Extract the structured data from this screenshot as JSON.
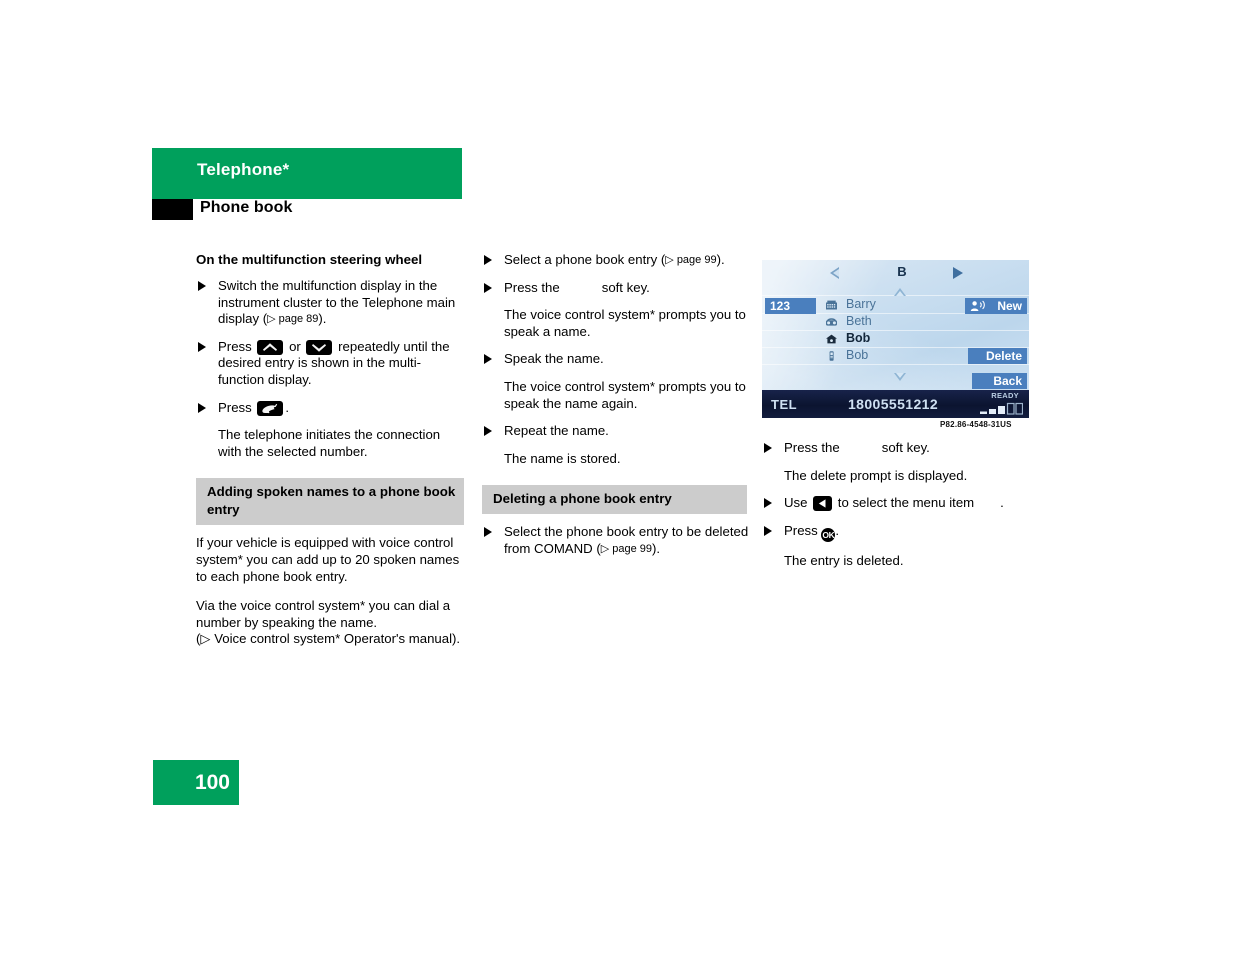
{
  "header": {
    "chapter_title": "Telephone*",
    "section_title": "Phone book",
    "accent_color": "#00A05C"
  },
  "left_column": {
    "subhead": "On the multifunction steering wheel",
    "step1": {
      "text_before": "Switch the multifunction display in the instrument cluster to the Telephone main display (",
      "ref": "▷ page 89",
      "text_after": ")."
    },
    "step2": {
      "press_label": "Press",
      "or_label": "or",
      "text_after": "repeatedly until the desired entry is shown in the multi-function display."
    },
    "step3": {
      "press_label": "Press",
      "text_after": "."
    },
    "result1": "The telephone initiates the connection with the selected number.",
    "band_adding": "Adding spoken names to a phone book entry",
    "para1": "If your vehicle is equipped with voice control system* you can add up to 20 spoken names to each phone book entry.",
    "para2a": "Via the voice control system* you can dial a number by speaking the name.",
    "para2b": "(▷ Voice control system* Operator's manual)."
  },
  "mid_column": {
    "step1": {
      "text_before": "Select a phone book entry (",
      "ref": "▷ page 99",
      "text_after": ")."
    },
    "step2_before": "Press the",
    "step2_after": "soft key.",
    "result1": "The voice control system* prompts you to speak a name.",
    "step3": "Speak the name.",
    "result2": "The voice control system* prompts you to speak the name again.",
    "step4": "Repeat the name.",
    "result3": "The name is stored.",
    "band_deleting": "Deleting a phone book entry",
    "step5": {
      "text_before": "Select the phone book entry to be deleted from COMAND (",
      "ref": "▷ page 99",
      "text_after": ")."
    }
  },
  "comand_display": {
    "header_letter": "B",
    "index_button": "123",
    "entries": [
      {
        "icon": "office-icon",
        "name": "Barry",
        "selected": false
      },
      {
        "icon": "fax-icon",
        "name": "Beth",
        "selected": false
      },
      {
        "icon": "home-icon",
        "name": "Bob",
        "selected": true
      },
      {
        "icon": "mobile-icon",
        "name": "Bob",
        "selected": false
      }
    ],
    "soft_keys": [
      {
        "label": "New",
        "icon": "new-voice-entry-icon"
      },
      {
        "label": "Delete",
        "icon": ""
      },
      {
        "label": "Back",
        "icon": ""
      }
    ],
    "status": {
      "mode": "TEL",
      "number": "18005551212",
      "ready": "READY",
      "signal_bars_filled": 2,
      "signal_bars_total": 4
    },
    "accent_blue": "#4a7fbe",
    "caption": "P82.86-4548-31US"
  },
  "right_column": {
    "step1_before": "Press the",
    "step1_after": "soft key.",
    "result1": "The delete prompt is displayed.",
    "step2_before": "Use",
    "step2_mid": "to select the menu item",
    "step2_after": ".",
    "step3_before": "Press",
    "step3_after": ".",
    "result2": "The entry is deleted."
  },
  "footer": {
    "page_number": "100"
  }
}
